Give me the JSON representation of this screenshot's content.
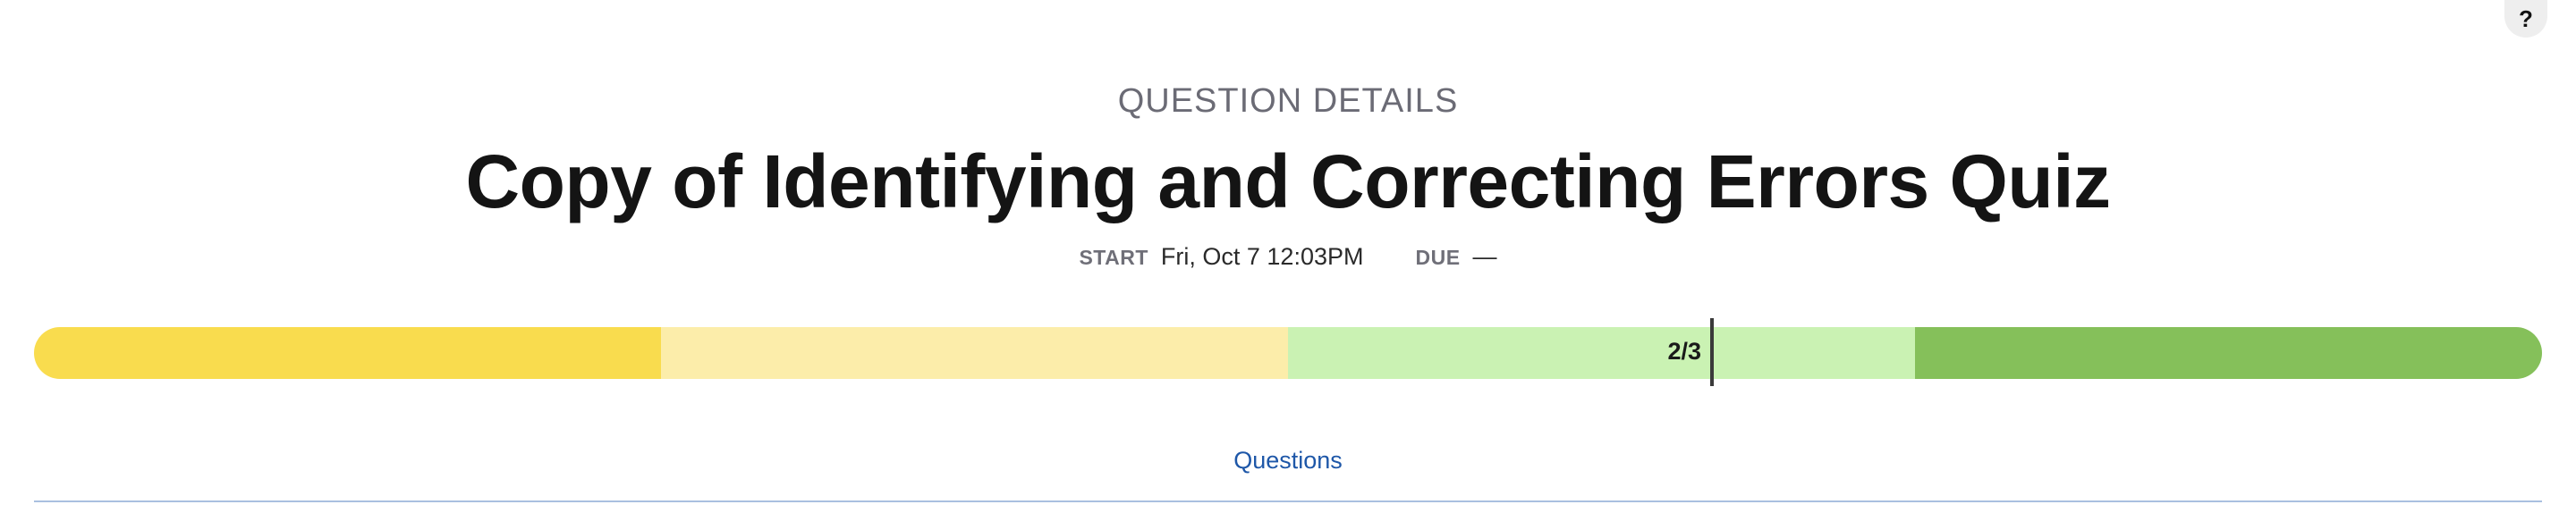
{
  "help_button": {
    "label": "?"
  },
  "header": {
    "kicker": "QUESTION DETAILS",
    "title": "Copy of Identifying and Correcting Errors Quiz"
  },
  "meta": {
    "start_label": "START",
    "start_value": "Fri, Oct 7 12:03PM",
    "due_label": "DUE",
    "due_value": "—"
  },
  "progress": {
    "marker_label": "2/3",
    "marker_fraction": 0.669,
    "segments": [
      {
        "fraction": 0.25,
        "color": "#f9dc4e"
      },
      {
        "fraction": 0.25,
        "color": "#fcedaa"
      },
      {
        "fraction": 0.25,
        "color": "#caf2b3"
      },
      {
        "fraction": 0.25,
        "color": "#85c05a"
      }
    ]
  },
  "tabs": [
    {
      "label": "Questions",
      "active": true
    }
  ],
  "colors": {
    "accent": "#1e57a8",
    "divider": "#a9c0e0"
  }
}
